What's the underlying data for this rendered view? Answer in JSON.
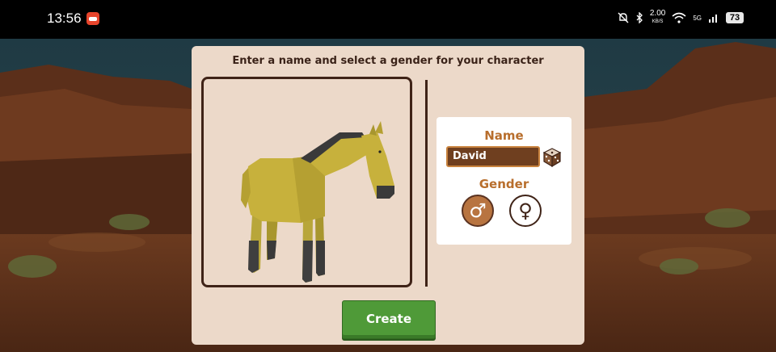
{
  "status_bar": {
    "time": "13:56",
    "speed_value": "2.00",
    "speed_unit": "KB/S",
    "network": "5G",
    "battery": "73"
  },
  "dialog": {
    "prompt": "Enter a name and select a gender for your character",
    "name_label": "Name",
    "name_value": "David",
    "gender_label": "Gender",
    "male_symbol": "♂",
    "female_symbol": "♀",
    "create_label": "Create",
    "selected_gender": "male"
  },
  "icons": {
    "dice": "dice-icon",
    "male": "male-symbol-icon",
    "female": "female-symbol-icon"
  },
  "colors": {
    "panel": "#ecd9c9",
    "border": "#3f2317",
    "accent": "#b86e2c",
    "create": "#4f9a38"
  }
}
